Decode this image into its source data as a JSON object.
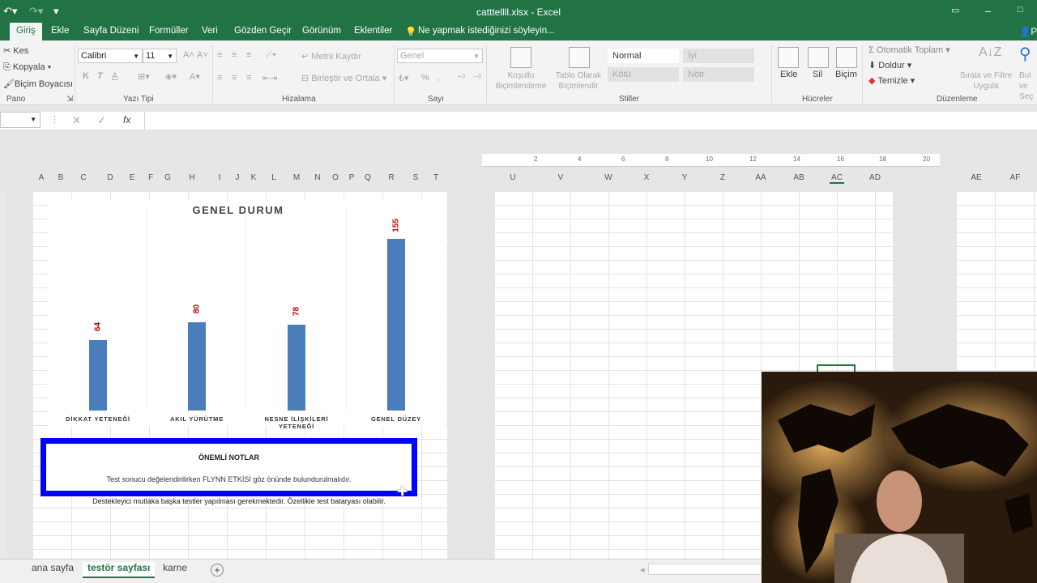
{
  "window": {
    "title": "catttellll.xlsx - Excel"
  },
  "ribbon_tabs": [
    "Giriş",
    "Ekle",
    "Sayfa Düzeni",
    "Formüller",
    "Veri",
    "Gözden Geçir",
    "Görünüm",
    "Eklentiler"
  ],
  "tell_me": "Ne yapmak istediğinizi söyleyin...",
  "account_initial": "P",
  "clipboard": {
    "cut": "Kes",
    "copy": "Kopyala",
    "painter": "Biçim Boyacısı",
    "label": "Pano"
  },
  "font": {
    "name": "Calibri",
    "size": "11",
    "bold": "K",
    "italic": "T",
    "underline": "A",
    "color": "A",
    "label": "Yazı Tipi"
  },
  "alignment": {
    "wrap": "Metni Kaydır",
    "merge": "Birleştir ve Ortala",
    "label": "Hizalama"
  },
  "number": {
    "format": "Genel",
    "percent": "%",
    "label": "Sayı"
  },
  "styles": {
    "conditional": "Koşullu Biçimlendirme",
    "table": "Tablo Olarak Biçimlendir",
    "normal": "Normal",
    "good": "İyi",
    "bad": "Kötü",
    "neutral": "Nötr",
    "label": "Stiller"
  },
  "cells": {
    "insert": "Ekle",
    "delete": "Sil",
    "format": "Biçim",
    "label": "Hücreler"
  },
  "editing": {
    "autosum": "Otomatik Toplam",
    "fill": "Doldur",
    "clear": "Temizle",
    "sort": "Sırala ve Filtre Uygula",
    "find": "Bul ve Seç",
    "label": "Düzenleme"
  },
  "formula_bar": {
    "cancel": "✕",
    "enter": "✓",
    "fx": "fx"
  },
  "ruler_ticks": [
    "2",
    "4",
    "6",
    "8",
    "10",
    "12",
    "14",
    "16",
    "18",
    "20"
  ],
  "columns_left": [
    "A",
    "B",
    "C",
    "D",
    "E",
    "F",
    "G",
    "H",
    "I",
    "J",
    "K",
    "L",
    "M",
    "N",
    "O",
    "P",
    "Q",
    "R",
    "S",
    "T"
  ],
  "columns_right": [
    "U",
    "V",
    "W",
    "X",
    "Y",
    "Z",
    "AA",
    "AB",
    "AC",
    "AD"
  ],
  "columns_far": [
    "AE",
    "AF"
  ],
  "chart_data": {
    "type": "bar",
    "title": "GENEL DURUM",
    "categories": [
      "DİKKAT YETENEĞİ",
      "AKIL YÜRÜTME",
      "NESNE İLİŞKİLERİ YETENEĞİ",
      "GENEL DÜZEY"
    ],
    "values": [
      64,
      80,
      78,
      155
    ],
    "ylim": [
      0,
      170
    ],
    "grid": false,
    "bar_color": "#4a7ebb",
    "label_color": "#c00000"
  },
  "notes": {
    "heading": "ÖNEMLİ NOTLAR",
    "line1": "Test sonucu değelendirilirken FLYNN ETKİSİ göz önünde bulundurulmalıdır.",
    "line2": "Destekleyici mutlaka başka testler yapılması gerekmektedir. Özellikle test bataryası olabilir."
  },
  "sheet_tabs": [
    "ana sayfa",
    "testör sayfası",
    "karne"
  ],
  "add_sheet": "+",
  "colors": {
    "excel_green": "#217346",
    "note_border": "#0000ff"
  }
}
